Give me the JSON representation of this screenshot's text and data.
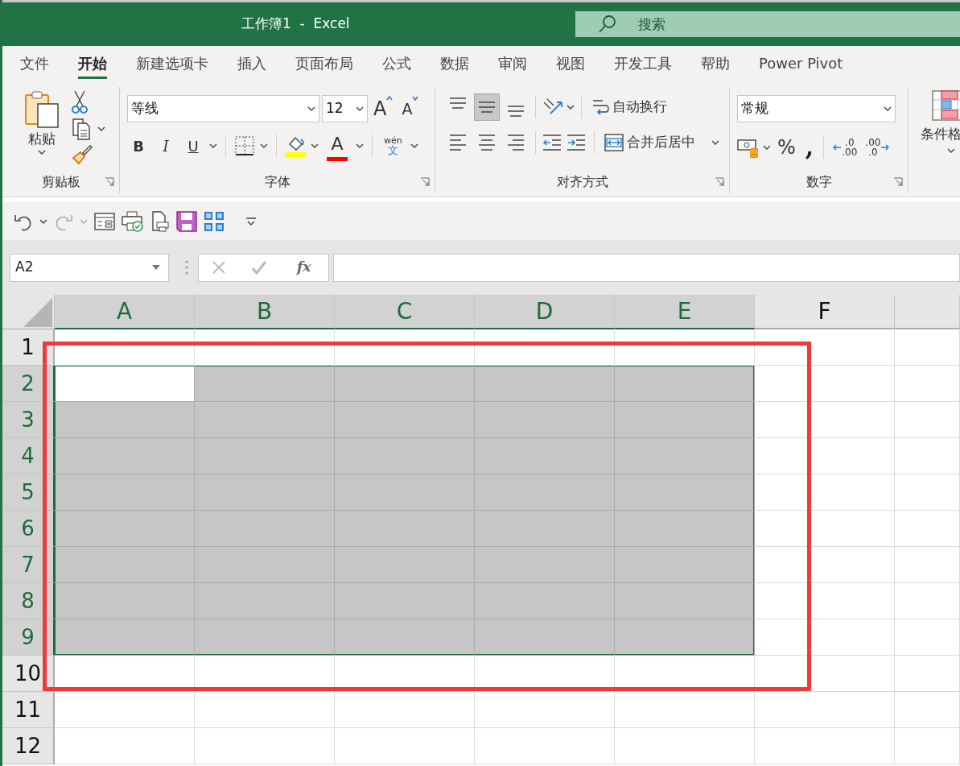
{
  "window": {
    "title": "工作簿1  -  Excel"
  },
  "search": {
    "placeholder": "搜索"
  },
  "tabs": [
    {
      "label": "文件",
      "selected": false
    },
    {
      "label": "开始",
      "selected": true
    },
    {
      "label": "新建选项卡",
      "selected": false
    },
    {
      "label": "插入",
      "selected": false
    },
    {
      "label": "页面布局",
      "selected": false
    },
    {
      "label": "公式",
      "selected": false
    },
    {
      "label": "数据",
      "selected": false
    },
    {
      "label": "审阅",
      "selected": false
    },
    {
      "label": "视图",
      "selected": false
    },
    {
      "label": "开发工具",
      "selected": false
    },
    {
      "label": "帮助",
      "selected": false
    },
    {
      "label": "Power Pivot",
      "selected": false
    }
  ],
  "ribbon": {
    "clipboard": {
      "paste_label": "粘贴",
      "group_label": "剪贴板"
    },
    "font": {
      "font_name": "等线",
      "font_size": "12",
      "grow_font": "A",
      "shrink_font": "A",
      "bold": "B",
      "italic": "I",
      "underline": "U",
      "font_color": "A",
      "phonetic_top": "wén",
      "phonetic_bottom": "文",
      "group_label": "字体"
    },
    "alignment": {
      "vertical_align": [
        {
          "selected": false
        },
        {
          "selected": true
        },
        {
          "selected": false
        }
      ],
      "wrap_text": "自动换行",
      "merge_center": "合并后居中",
      "group_label": "对齐方式"
    },
    "number": {
      "format": "常规",
      "percent": "%",
      "comma": ",",
      "decimal_increase": {
        "top": ".0",
        "bottom": ".00"
      },
      "decimal_decrease": {
        "top": ".00",
        "bottom": ".0"
      },
      "group_label": "数字"
    },
    "styles": {
      "conditional_label": "条件格"
    }
  },
  "name_box": {
    "value": "A2"
  },
  "formula_bar": {
    "function_label": "fx"
  },
  "columns": [
    {
      "label": "A",
      "selected": true,
      "active": true
    },
    {
      "label": "B",
      "selected": true,
      "active": false
    },
    {
      "label": "C",
      "selected": true,
      "active": false
    },
    {
      "label": "D",
      "selected": true,
      "active": false
    },
    {
      "label": "E",
      "selected": true,
      "active": false
    },
    {
      "label": "F",
      "selected": false,
      "active": false
    }
  ],
  "rows": [
    {
      "label": "1",
      "selected": false,
      "active": false
    },
    {
      "label": "2",
      "selected": true,
      "active": true
    },
    {
      "label": "3",
      "selected": true,
      "active": false
    },
    {
      "label": "4",
      "selected": true,
      "active": false
    },
    {
      "label": "5",
      "selected": true,
      "active": false
    },
    {
      "label": "6",
      "selected": true,
      "active": false
    },
    {
      "label": "7",
      "selected": true,
      "active": false
    },
    {
      "label": "8",
      "selected": true,
      "active": false
    },
    {
      "label": "9",
      "selected": true,
      "active": false
    },
    {
      "label": "10",
      "selected": false,
      "active": false
    },
    {
      "label": "11",
      "selected": false,
      "active": false
    },
    {
      "label": "12",
      "selected": false,
      "active": false
    }
  ]
}
